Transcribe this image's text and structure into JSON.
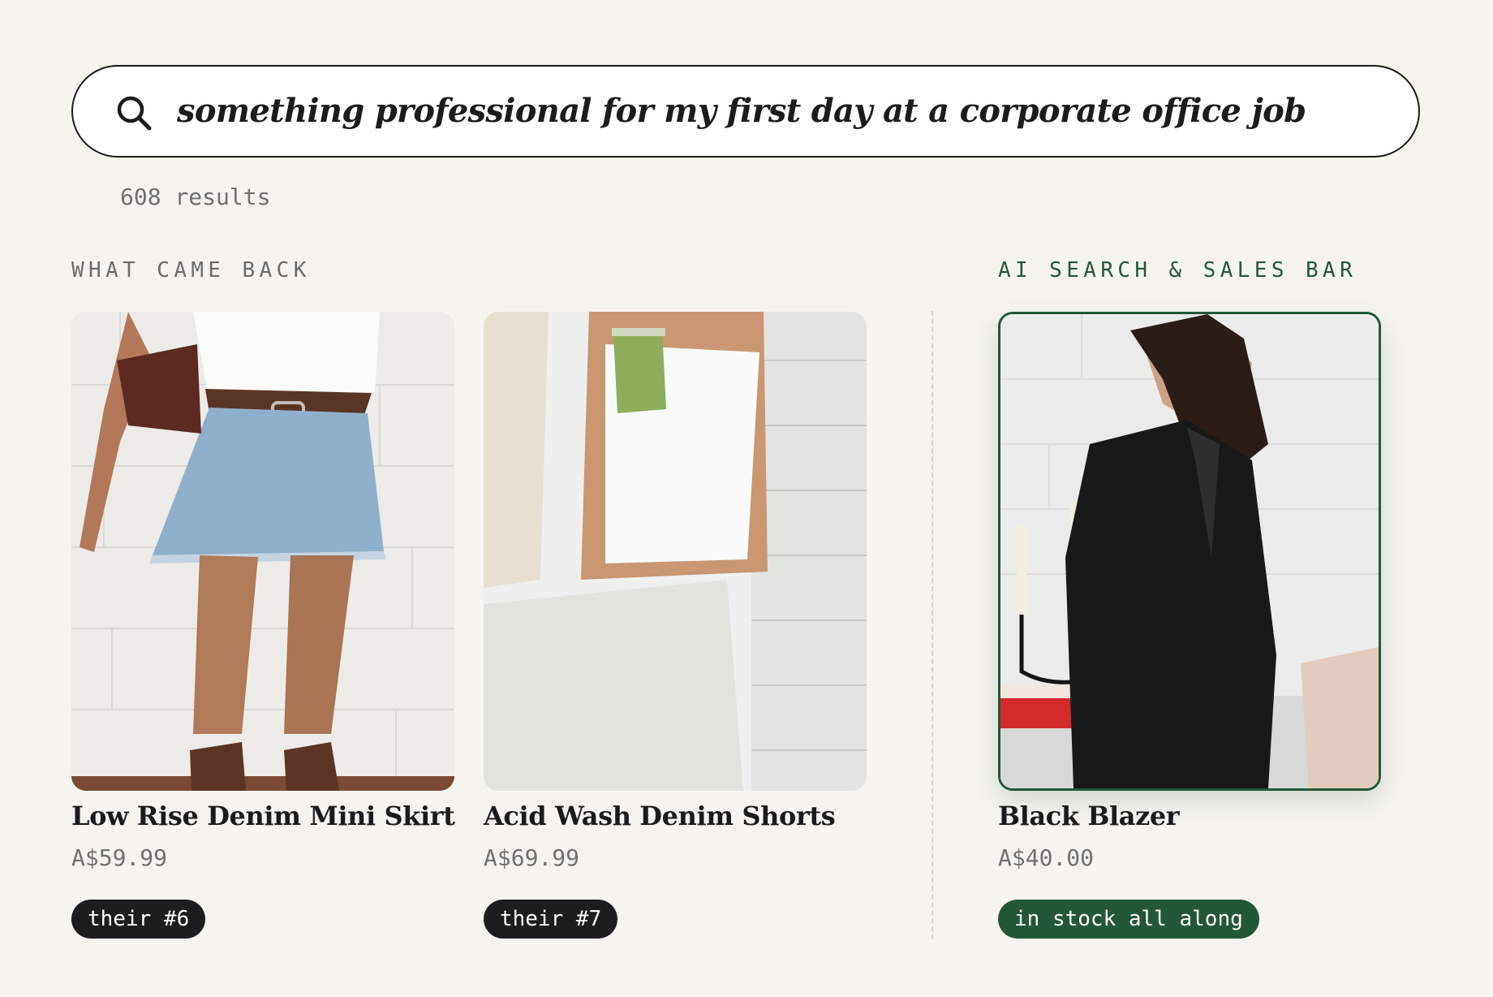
{
  "search": {
    "query": "something professional for my first day at a corporate office job",
    "results_count": "608 results"
  },
  "sections": {
    "left_label": "WHAT CAME BACK",
    "right_label": "AI SEARCH & SALES BAR"
  },
  "products": [
    {
      "title": "Low Rise Denim Mini Skirt",
      "price": "A$59.99",
      "badge": "their #6",
      "image": "denim-mini-skirt-photo"
    },
    {
      "title": "Acid Wash Denim Shorts",
      "price": "A$69.99",
      "badge": "their #7",
      "image": "denim-shorts-photo"
    },
    {
      "title": "Black Blazer",
      "price": "A$40.00",
      "badge": "in stock all along",
      "image": "black-blazer-photo"
    }
  ],
  "colors": {
    "background": "#f6f4ef",
    "accent_green": "#23573a",
    "badge_dark": "#1d1d1d",
    "muted_text": "#6f6f6f"
  }
}
